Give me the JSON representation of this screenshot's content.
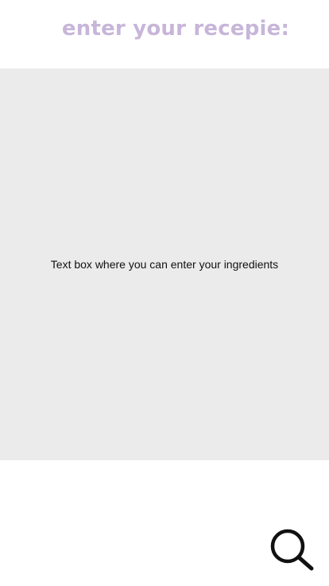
{
  "header": {
    "title": "enter your recepie:"
  },
  "ingredients_box": {
    "placeholder": "Text box where you can enter your ingredients"
  },
  "search": {
    "icon": "search-icon"
  },
  "colors": {
    "title": "#c7b6d9",
    "text_box_background": "#ebebeb",
    "icon": "#111111",
    "page_background": "#ffffff"
  }
}
